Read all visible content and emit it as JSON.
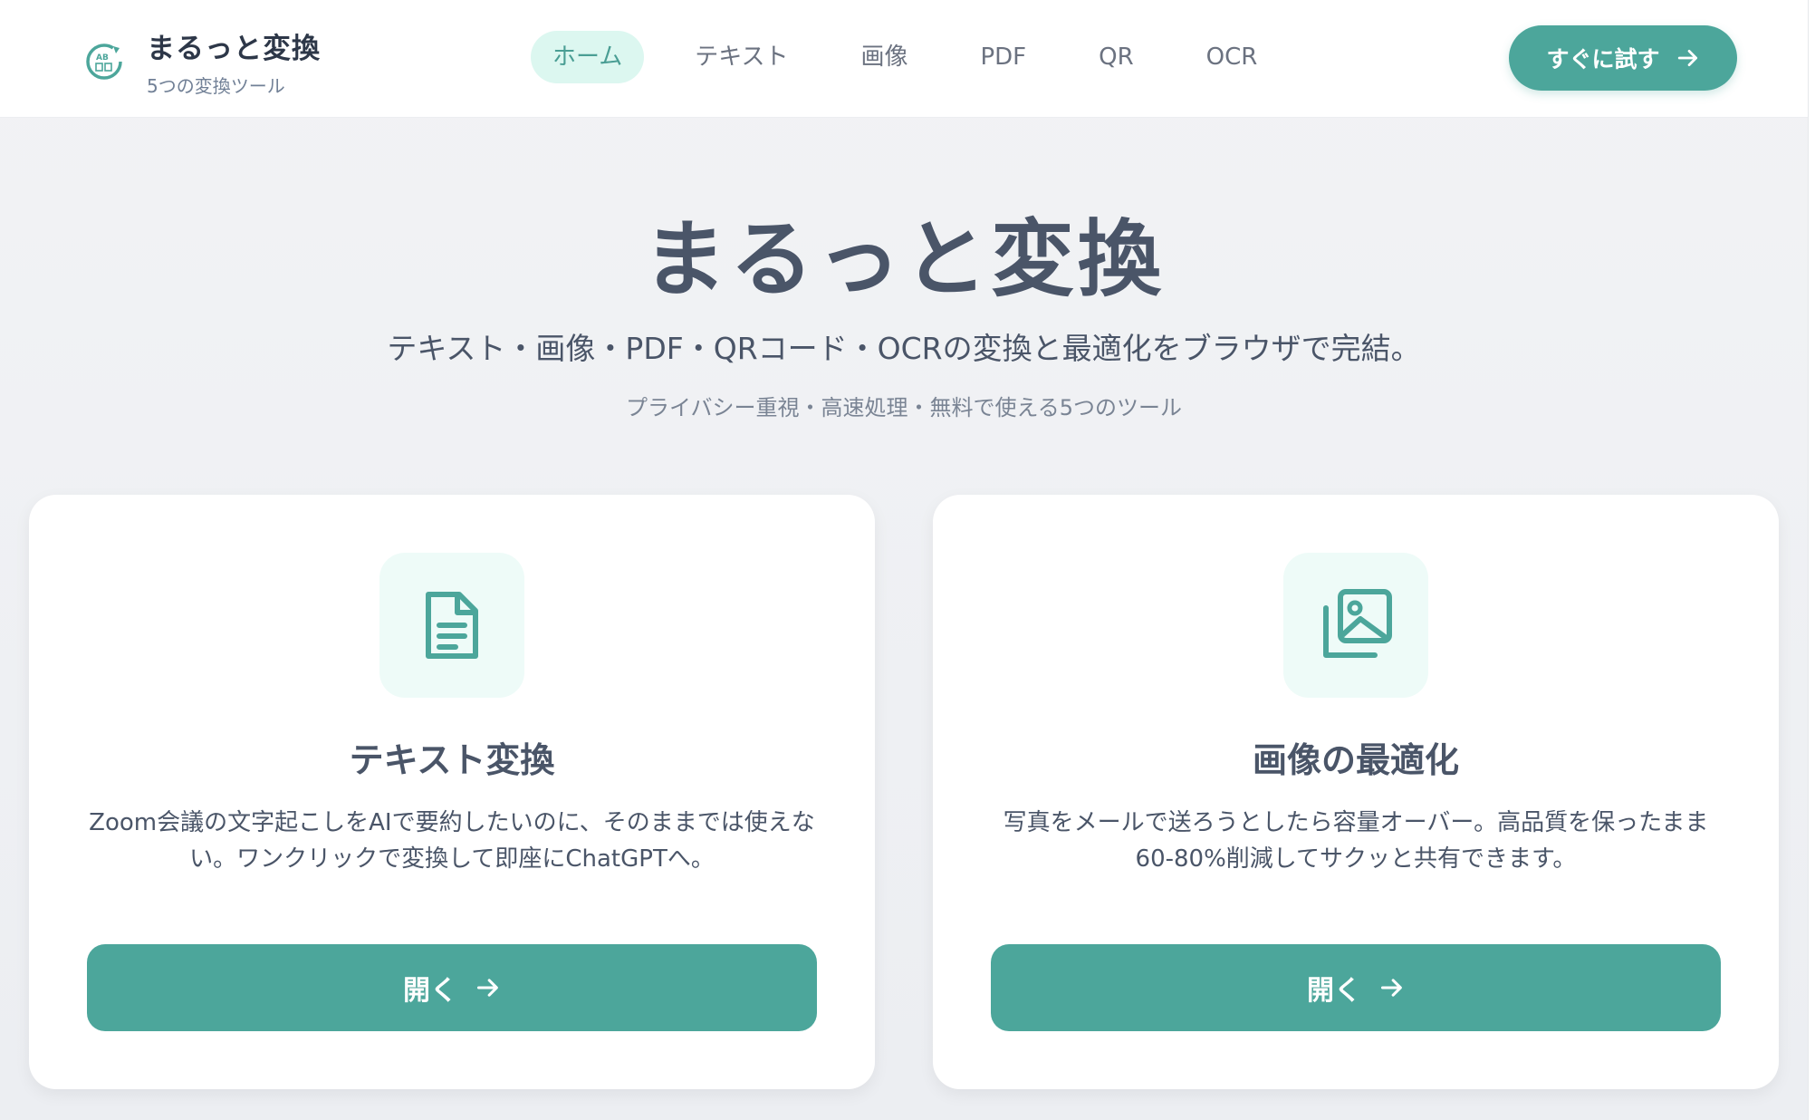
{
  "header": {
    "brand_title": "まるっと変換",
    "brand_subtitle": "5つの変換ツール",
    "logo_icon": "conversion-logo-icon",
    "nav": [
      {
        "label": "ホーム",
        "active": true
      },
      {
        "label": "テキスト",
        "active": false
      },
      {
        "label": "画像",
        "active": false
      },
      {
        "label": "PDF",
        "active": false
      },
      {
        "label": "QR",
        "active": false
      },
      {
        "label": "OCR",
        "active": false
      }
    ],
    "cta_label": "すぐに試す"
  },
  "hero": {
    "title": "まるっと変換",
    "subtitle": "テキスト・画像・PDF・QRコード・OCRの変換と最適化をブラウザで完結。",
    "note": "プライバシー重視・高速処理・無料で使える5つのツール"
  },
  "cards": [
    {
      "icon": "document-icon",
      "title": "テキスト変換",
      "description": "Zoom会議の文字起こしをAIで要約したいのに、そのままでは使えない。ワンクリックで変換して即座にChatGPTへ。",
      "button_label": "開く"
    },
    {
      "icon": "image-gallery-icon",
      "title": "画像の最適化",
      "description": "写真をメールで送ろうとしたら容量オーバー。高品質を保ったまま60-80%削減してサクッと共有できます。",
      "button_label": "開く"
    }
  ],
  "colors": {
    "accent": "#4ca69b",
    "accent_light": "#dcf7f0",
    "icon_bg": "#eefbf8",
    "text": "#4a5568"
  }
}
